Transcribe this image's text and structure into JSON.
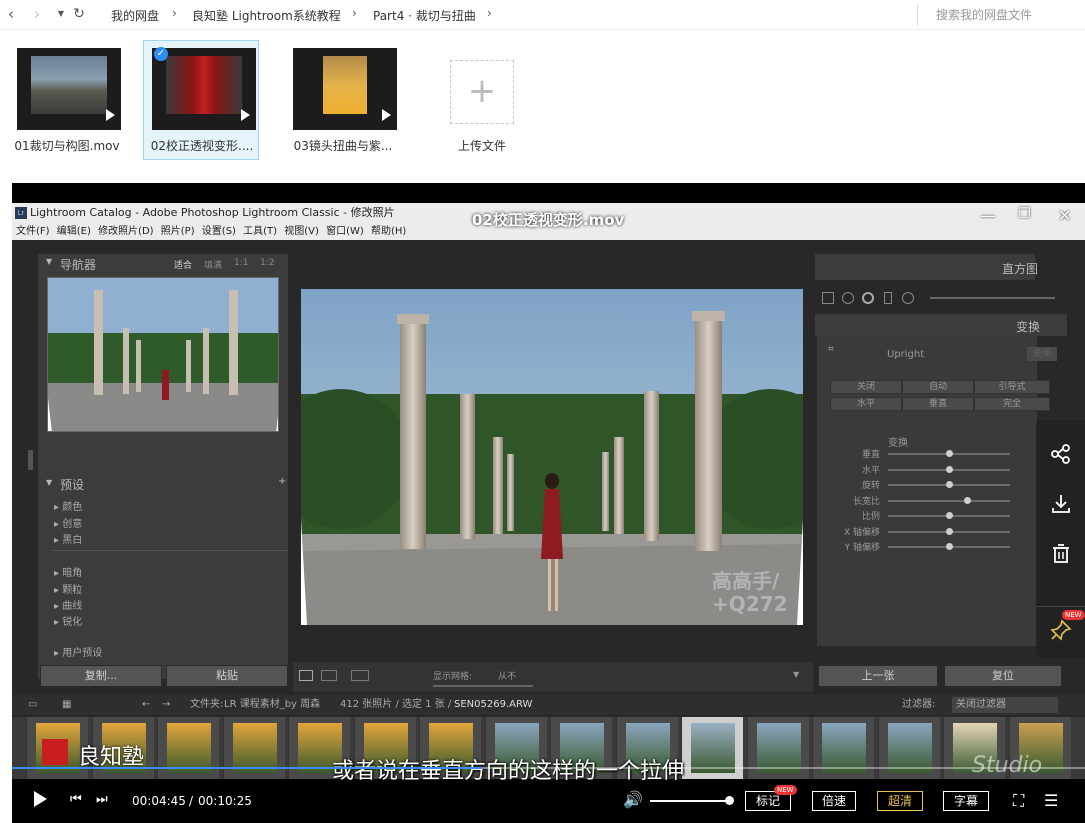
{
  "topbar": {
    "breadcrumbs": [
      "我的网盘",
      "良知塾 Lightroom系统教程",
      "Part4 · 裁切与扭曲"
    ],
    "search_placeholder": "搜索我的网盘文件"
  },
  "files": [
    {
      "name": "01裁切与构图.mov"
    },
    {
      "name": "02校正透视变形...."
    },
    {
      "name": "03镜头扭曲与紫..."
    }
  ],
  "upload_label": "上传文件",
  "player": {
    "video_title": "02校正透视变形.mov",
    "lr_window_title": "Lightroom Catalog - Adobe Photoshop Lightroom Classic - 修改照片",
    "lr_logo": "Lr",
    "menu": [
      "文件(F)",
      "编辑(E)",
      "修改照片(D)",
      "照片(P)",
      "设置(S)",
      "工具(T)",
      "视图(V)",
      "窗口(W)",
      "帮助(H)"
    ],
    "navigator": {
      "title": "导航器",
      "zoom_opts": [
        "适合",
        "填满",
        "1:1",
        "1:2"
      ]
    },
    "presets": {
      "title": "预设",
      "items": [
        "颜色",
        "创意",
        "黑白",
        "暗角",
        "颗粒",
        "曲线",
        "锐化",
        "用户预设"
      ]
    },
    "left_buttons": {
      "copy": "复制...",
      "paste": "粘贴"
    },
    "toolbar": {
      "grid_label": "显示网格:",
      "grid_value": "从不"
    },
    "histogram_title": "直方图",
    "transform": {
      "title": "变换",
      "upright": "Upright",
      "upright_off": "关闭",
      "row1": [
        "关闭",
        "自动",
        "引导式"
      ],
      "row2": [
        "水平",
        "垂直",
        "完全"
      ],
      "section": "变换",
      "sliders": [
        {
          "label": "垂直",
          "pos": 0.5
        },
        {
          "label": "水平",
          "pos": 0.5
        },
        {
          "label": "旋转",
          "pos": 0.5
        },
        {
          "label": "长宽比",
          "pos": 0.65
        },
        {
          "label": "比例",
          "pos": 0.5
        },
        {
          "label": "X 轴偏移",
          "pos": 0.5
        },
        {
          "label": "Y 轴偏移",
          "pos": 0.5
        }
      ]
    },
    "right_buttons": {
      "prev": "上一张",
      "reset": "复位"
    },
    "filmstrip_bar": {
      "folder_prefix": "文件夹:",
      "folder": "LR 课程素材_by 周森",
      "counts": "412 张照片 / 选定 1 张 /",
      "filename": "SEN05269.ARW",
      "filter_label": "过滤器:",
      "filter_value": "关闭过滤器"
    },
    "watermark": {
      "line1": "高高手/",
      "line2": "+Q272"
    },
    "brand": "良知塾",
    "studio": "Studio",
    "subtitle": "或者说在垂直方向的这样的一个拉伸",
    "progress": 0.4377,
    "time_current": "00:04:45",
    "time_total": "00:10:25",
    "volume": 1.0,
    "pills": [
      "标记",
      "倍速",
      "超清",
      "字幕"
    ],
    "new_badge": "NEW"
  },
  "side_actions": {
    "share": "share-icon",
    "download": "download-icon",
    "delete": "trash-icon",
    "pin": "pin-icon",
    "new_badge": "NEW"
  },
  "colors": {
    "accent_blue": "#3b8cff",
    "highlight_gold": "#e6c14b",
    "badge_red": "#e33333"
  }
}
